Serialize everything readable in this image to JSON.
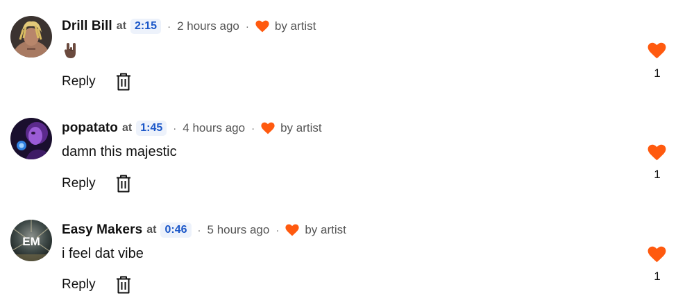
{
  "comments": [
    {
      "username": "Drill Bill",
      "at_label": "at",
      "timestamp": "2:15",
      "ago": "2 hours ago",
      "by_artist": "by artist",
      "content_emoji": "rock-hand-emoji",
      "reply_label": "Reply",
      "like_count": "1"
    },
    {
      "username": "popatato",
      "at_label": "at",
      "timestamp": "1:45",
      "ago": "4 hours ago",
      "by_artist": "by artist",
      "text": "damn this majestic",
      "reply_label": "Reply",
      "like_count": "1"
    },
    {
      "username": "Easy Makers",
      "at_label": "at",
      "timestamp": "0:46",
      "ago": "5 hours ago",
      "by_artist": "by artist",
      "text": "i feel dat vibe",
      "reply_label": "Reply",
      "like_count": "1",
      "avatar_initials": "EM"
    }
  ],
  "colors": {
    "heart": "#ff5a0f",
    "timestamp_text": "#1a56c8",
    "timestamp_bg": "#edf2fb"
  },
  "icons": {
    "separator": "·",
    "heart": "heart-icon",
    "delete": "trash-icon"
  }
}
